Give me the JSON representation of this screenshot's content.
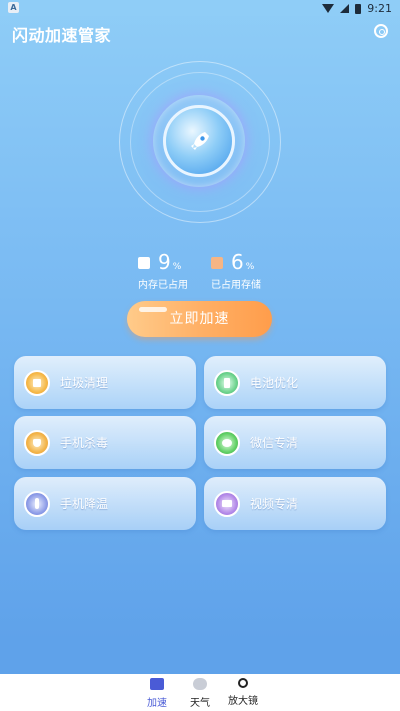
{
  "status_bar": {
    "left_badge": "A",
    "time": "9:21"
  },
  "header": {
    "title": "闪动加速管家"
  },
  "stats": [
    {
      "value": "9",
      "unit": "%",
      "label": "内存已占用",
      "color": "#ffffff"
    },
    {
      "value": "6",
      "unit": "%",
      "label": "已占用存储",
      "color": "#f6b584"
    }
  ],
  "boost_button": {
    "label": "立即加速"
  },
  "features": [
    {
      "label": "垃圾清理",
      "icon": "trash-icon"
    },
    {
      "label": "电池优化",
      "icon": "battery-icon"
    },
    {
      "label": "手机杀毒",
      "icon": "shield-icon"
    },
    {
      "label": "微信专清",
      "icon": "wechat-icon"
    },
    {
      "label": "手机降温",
      "icon": "thermometer-icon"
    },
    {
      "label": "视频专清",
      "icon": "video-icon"
    }
  ],
  "bottom_nav": [
    {
      "label": "加速",
      "icon": "toolbox-icon",
      "active": true
    },
    {
      "label": "天气",
      "icon": "cloud-icon",
      "active": false
    },
    {
      "label": "放大镜",
      "icon": "magnifier-icon",
      "active": false
    }
  ],
  "colors": {
    "accent": "#ffa45a",
    "nav_active": "#4a5bd6",
    "background_top": "#8fcdf7",
    "background_bottom": "#5fa2ea"
  }
}
